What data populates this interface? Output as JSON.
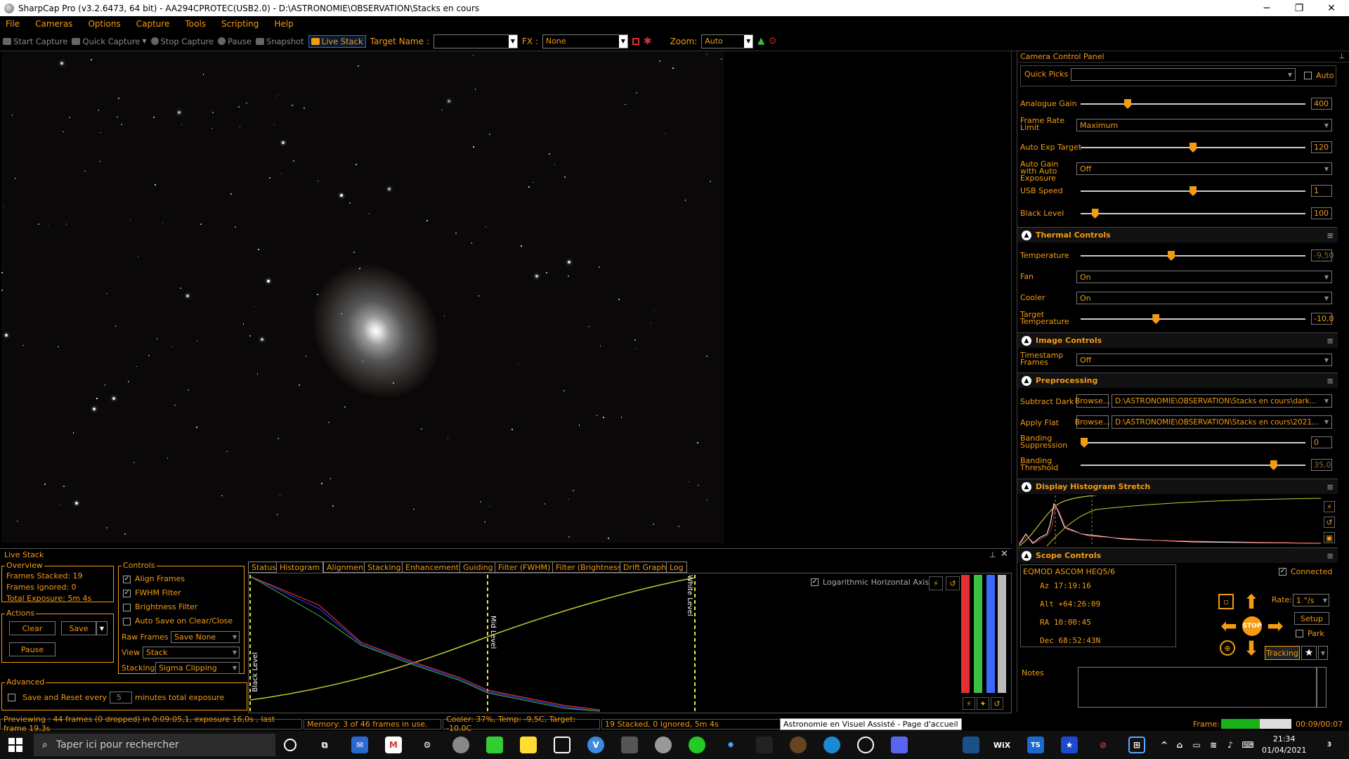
{
  "window": {
    "title": "SharpCap Pro (v3.2.6473, 64 bit) - AA294CPROTEC(USB2.0) - D:\\ASTRONOMIE\\OBSERVATION\\Stacks en cours",
    "minimize": "─",
    "maximize": "❐",
    "close": "✕"
  },
  "menu": [
    "File",
    "Cameras",
    "Options",
    "Capture",
    "Tools",
    "Scripting",
    "Help"
  ],
  "toolbar": {
    "start_capture": "Start Capture",
    "quick_capture": "Quick Capture",
    "stop_capture": "Stop Capture",
    "pause": "Pause",
    "snapshot": "Snapshot",
    "live_stack": "Live Stack",
    "target_name_label": "Target Name :",
    "target_name_value": "",
    "fx_label": "FX :",
    "fx_value": "None",
    "zoom_label": "Zoom:",
    "zoom_value": "Auto"
  },
  "camera_panel": {
    "title": "Camera Control Panel",
    "quick_picks_label": "Quick Picks",
    "quick_picks_value": "",
    "auto_label": "Auto",
    "analogue_gain": {
      "label": "Analogue Gain",
      "value": "400",
      "fraction": 0.2
    },
    "frame_rate": {
      "label": "Frame Rate Limit",
      "value": "Maximum"
    },
    "auto_exp_target": {
      "label": "Auto Exp Target",
      "value": "120",
      "fraction": 0.5
    },
    "auto_gain": {
      "label": "Auto Gain with Auto Exposure",
      "value": "Off"
    },
    "usb_speed": {
      "label": "USB Speed",
      "value": "1",
      "fraction": 0.5
    },
    "black_level": {
      "label": "Black Level",
      "value": "100",
      "fraction": 0.05
    },
    "thermal": {
      "title": "Thermal Controls",
      "temperature": {
        "label": "Temperature",
        "value": "-9,50",
        "fraction": 0.4
      },
      "fan": {
        "label": "Fan",
        "value": "On"
      },
      "cooler": {
        "label": "Cooler",
        "value": "On"
      },
      "target_temperature": {
        "label": "Target Temperature",
        "value": "-10,0",
        "fraction": 0.33
      }
    },
    "image_controls": {
      "title": "Image Controls",
      "timestamp": {
        "label": "Timestamp Frames",
        "value": "Off"
      }
    },
    "preprocessing": {
      "title": "Preprocessing",
      "subtract_dark": {
        "label": "Subtract Dark",
        "button": "Browse...",
        "value": "D:\\ASTRONOMIE\\OBSERVATION\\Stacks en cours\\dark..."
      },
      "apply_flat": {
        "label": "Apply Flat",
        "button": "Browse...",
        "value": "D:\\ASTRONOMIE\\OBSERVATION\\Stacks en cours\\2021..."
      },
      "banding_suppression": {
        "label": "Banding Suppression",
        "value": "0",
        "fraction": 0.0
      },
      "banding_threshold": {
        "label": "Banding Threshold",
        "value": "35,0",
        "fraction": 0.87
      }
    },
    "histogram": {
      "title": "Display Histogram Stretch"
    },
    "scope": {
      "title": "Scope Controls",
      "mount": "EQMOD ASCOM HEQ5/6",
      "connected": "Connected",
      "az": "Az  17:19:16",
      "alt": "Alt +64:26:09",
      "ra": "RA  10:00:45",
      "dec": "Dec  68:52:43N",
      "rate_label": "Rate:",
      "rate_value": "1 °/s",
      "setup": "Setup",
      "park": "Park",
      "tracking": "Tracking",
      "stop": "STOP",
      "notes_label": "Notes"
    }
  },
  "live_stack": {
    "title": "Live Stack",
    "overview": {
      "title": "Overview",
      "frames_stacked": "Frames Stacked:  19",
      "frames_ignored": "Frames Ignored:   0",
      "total_exposure": "Total Exposure:   5m 4s"
    },
    "actions": {
      "title": "Actions",
      "clear": "Clear",
      "save": "Save",
      "pause": "Pause"
    },
    "advanced": {
      "title": "Advanced",
      "save_reset": "Save and Reset every",
      "minutes_value": "5",
      "minutes_label": "minutes total exposure"
    },
    "controls": {
      "title": "Controls",
      "align_frames": "Align Frames",
      "fwhm_filter": "FWHM Filter",
      "brightness_filter": "Brightness Filter",
      "auto_save": "Auto Save on Clear/Close",
      "raw_frames_label": "Raw Frames",
      "raw_frames_value": "Save None",
      "view_label": "View",
      "view_value": "Stack",
      "stacking_label": "Stacking",
      "stacking_value": "Sigma Clipping"
    },
    "tabs": [
      "Status",
      "Histogram",
      "Alignment",
      "Stacking",
      "Enhancement",
      "Guiding",
      "Filter (FWHM)",
      "Filter (Brightness)",
      "Drift Graph",
      "Log"
    ],
    "log_axis": "Logarithmic Horizontal Axis",
    "black_level_marker": "Black Level",
    "mid_level_marker": "Mid Level",
    "white_level_marker": "White Level"
  },
  "status": {
    "preview": "Previewing : 44 frames (0 dropped) in 0:09:05,1, exposure 16,0s , last frame 19,3s",
    "memory": "Memory: 3 of 46 frames in use.",
    "cooler": "Cooler: 37%, Temp: -9,5C, Target: -10,0C",
    "stacked": "19 Stacked, 0 Ignored, 5m 4s",
    "tooltip": "Astronomie en Visuel Assisté - Page d'accueil",
    "frame_label": "Frame:",
    "frame_time": "00:09/00:07",
    "frame_progress": 0.55
  },
  "taskbar": {
    "search_placeholder": "Taper ici pour rechercher",
    "time": "21:34",
    "date": "01/04/2021",
    "notification_count": "3"
  },
  "colors": {
    "accent": "#f39c12",
    "selected_border": "#3c6db0"
  }
}
